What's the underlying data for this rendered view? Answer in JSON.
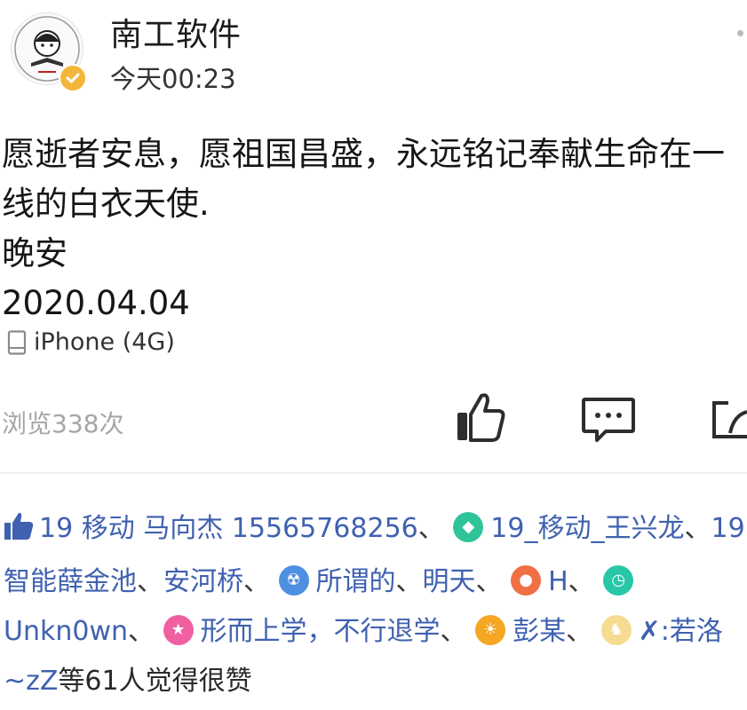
{
  "post": {
    "author": "南工软件",
    "time": "今天00:23",
    "content_lines": [
      "愿逝者安息，愿祖国昌盛，永远铭记奉献生命在一线的白衣天使.",
      "晚安",
      "2020.04.04"
    ],
    "device": "iPhone (4G)",
    "views": "浏览338次"
  },
  "likes": {
    "names": [
      "19 移动 马向杰 15565768256",
      "19_移动_王兴龙",
      "19智能薛金池",
      "安河桥",
      "所谓的",
      "明天",
      "H",
      "Unkn0wn",
      "形而上学，不行退学",
      "彭某",
      ":若洛~zZ"
    ],
    "separator": "、",
    "tail": "等61人觉得很赞"
  },
  "icons": {
    "avatar": "school-logo-avatar",
    "verified": "verified-check-icon",
    "device": "phone-icon",
    "like": "thumbs-up-icon",
    "comment": "comment-icon",
    "share": "share-icon"
  },
  "colors": {
    "link": "#3f61b0",
    "verified": "#f4b63a",
    "muted": "#a6a6a6"
  }
}
